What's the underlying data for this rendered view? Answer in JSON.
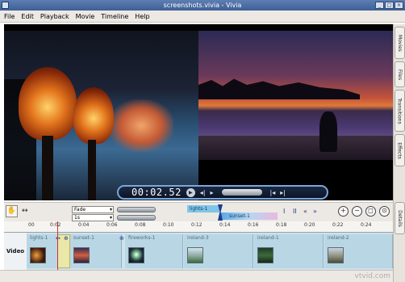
{
  "window": {
    "title": "screenshots.vivia - Vivia"
  },
  "menu": [
    {
      "label": "File"
    },
    {
      "label": "Edit"
    },
    {
      "label": "Playback"
    },
    {
      "label": "Movie"
    },
    {
      "label": "Timeline"
    },
    {
      "label": "Help"
    }
  ],
  "player": {
    "timecode": "00:02.52"
  },
  "side_tabs": [
    "Movies",
    "Files",
    "Transitions",
    "Effects",
    "Details"
  ],
  "transition": {
    "type": "Fade",
    "duration": "1s",
    "clip_a": "lights-1",
    "clip_b": "sunset-1"
  },
  "timeline": {
    "track_name": "Video",
    "ruler_ticks": [
      "00",
      "0:02",
      "0:04",
      "0:06",
      "0:08",
      "0:10",
      "0:12",
      "0:14",
      "0:16",
      "0:18",
      "0:20",
      "0:22",
      "0:24"
    ],
    "clips": [
      "lights-1",
      "sunset-1",
      "fireworks-1",
      "ireland-3",
      "ireland-1",
      "ireland-2"
    ]
  },
  "watermark": "vtvid.com",
  "colors": {
    "title_bar": "#4a6aa3",
    "accent": "#7aa7d8",
    "playhead": "#d23030"
  }
}
